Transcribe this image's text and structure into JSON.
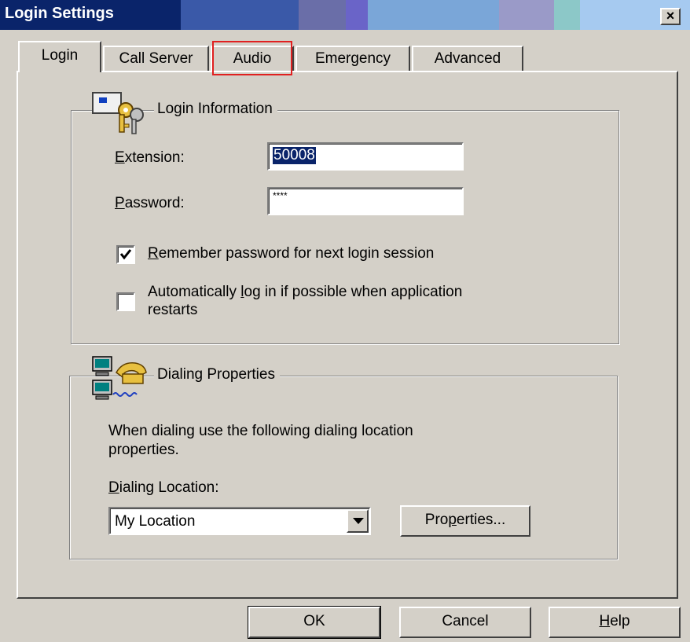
{
  "window": {
    "title": "Login Settings",
    "close_label": "×"
  },
  "tabs": [
    {
      "label": "Login",
      "active": true
    },
    {
      "label": "Call Server",
      "active": false
    },
    {
      "label": "Audio",
      "active": false
    },
    {
      "label": "Emergency",
      "active": false
    },
    {
      "label": "Advanced",
      "active": false
    }
  ],
  "login_info": {
    "group_label": "Login Information",
    "icon": "keys-icon",
    "extension_label_mnemonic": "E",
    "extension_label_rest": "xtension:",
    "extension_value": "50008",
    "password_label_mnemonic": "P",
    "password_label_rest": "assword:",
    "password_value": "****",
    "remember_pre": "",
    "remember_mnemonic": "R",
    "remember_rest": "emember password for next login session",
    "remember_checked": true,
    "autologin_line1_pre": "Automatically ",
    "autologin_line1_mnemonic": "l",
    "autologin_line1_rest": "og in if possible when application",
    "autologin_line2": "restarts",
    "autologin_checked": false
  },
  "dialing": {
    "group_label": "Dialing Properties",
    "icon": "computer-phone-icon",
    "desc_line1": "When dialing use the following dialing location",
    "desc_line2": "properties.",
    "location_label_mnemonic": "D",
    "location_label_rest": "ialing Location:",
    "location_value": "My Location",
    "properties_pre": "Pro",
    "properties_mnemonic": "p",
    "properties_rest": "erties..."
  },
  "buttons": {
    "ok": "OK",
    "cancel": "Cancel",
    "help_mnemonic": "H",
    "help_rest": "elp"
  },
  "colors": {
    "highlight_box": "#e02020",
    "selection": "#0a246a"
  }
}
